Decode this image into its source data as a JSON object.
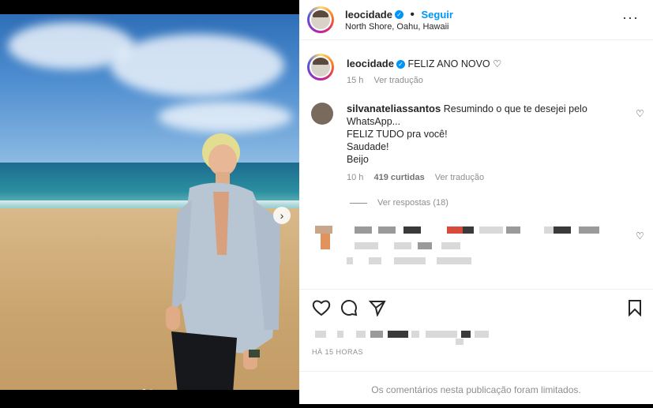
{
  "post": {
    "username": "leocidade",
    "follow_label": "Seguir",
    "location": "North Shore, Oahu, Hawaii",
    "more_icon": "more-options-icon"
  },
  "caption": {
    "username": "leocidade",
    "text": "FELIZ ANO NOVO",
    "time": "15 h",
    "translate": "Ver tradução"
  },
  "comments": [
    {
      "username": "silvanateliassantos",
      "lines": [
        "Resumindo o que te desejei pelo",
        "WhatsApp...",
        "FELIZ TUDO pra você!",
        "Saudade!",
        "Beijo"
      ],
      "time": "10 h",
      "likes": "419 curtidas",
      "translate": "Ver tradução",
      "replies": "Ver respostas (18)"
    }
  ],
  "footer": {
    "timestamp": "HÁ 15 HORAS",
    "limited_notice": "Os comentários nesta publicação foram limitados."
  },
  "colors": {
    "accent": "#0095f6",
    "muted": "#8e8e8e"
  }
}
